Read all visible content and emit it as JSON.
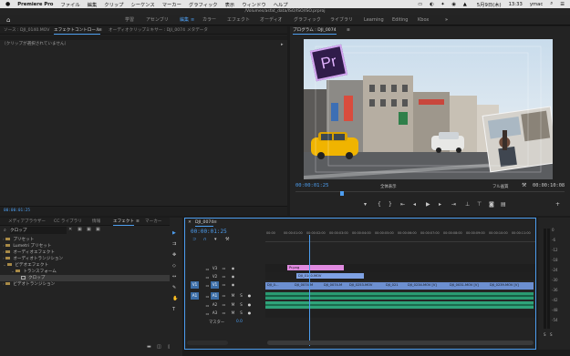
{
  "menubar": {
    "apple": "",
    "app": "Premiere Pro",
    "items": [
      "ファイル",
      "編集",
      "クリップ",
      "シーケンス",
      "マーカー",
      "グラフィック",
      "表示",
      "ウィンドウ",
      "ヘルプ"
    ],
    "status_date": "5月9日(木)",
    "status_time": "13:33",
    "status_user": "ymac"
  },
  "title_path": "/Volumes/asfat_data/ISO/ISO/ISO.prproj",
  "workspaces": {
    "items": [
      "学習",
      "アセンブリ",
      "編集",
      "カラー",
      "エフェクト",
      "オーディオ",
      "グラフィック",
      "ライブラリ",
      "Learning",
      "Editing",
      "Kbox"
    ],
    "active_index": 2,
    "more": "»"
  },
  "source_panel": {
    "tabs": [
      "ソース : DJI_0140.MOV",
      "エフェクトコントロール",
      "オーディオクリップミキサー : DJI_0074",
      "メタデータ"
    ],
    "menu": "≡",
    "active_tab": 1,
    "message": "（クリップが選択されていません）",
    "timecode": "00:00:01:25"
  },
  "program": {
    "title": "プログラム : DJI_0074",
    "menu": "≡",
    "timecode": "00:00:01:25",
    "fit": "全体表示",
    "quality": "フル画質",
    "duration": "00:00:10:08",
    "logo_text": "Pr"
  },
  "effects": {
    "tabs": [
      "メディアブラウザー",
      "CC ライブラリ",
      "情報",
      "エフェクト",
      "マーカー"
    ],
    "more": "»",
    "active_tab": 3,
    "search_value": "クロップ",
    "tree": [
      {
        "label": "プリセット",
        "indent": 0
      },
      {
        "label": "Lumetri プリセット",
        "indent": 0
      },
      {
        "label": "オーディオエフェクト",
        "indent": 0
      },
      {
        "label": "オーディオトランジション",
        "indent": 0
      },
      {
        "label": "ビデオエフェクト",
        "indent": 0
      },
      {
        "label": "トランスフォーム",
        "indent": 1
      },
      {
        "label": "クロップ",
        "indent": 2,
        "selected": true
      },
      {
        "label": "ビデオトランジション",
        "indent": 0
      }
    ]
  },
  "timeline": {
    "tab": "DJI_0074",
    "timecode": "00:00:01:25",
    "ruler": [
      "00:00",
      "00:00:01:00",
      "00:00:02:00",
      "00:00:03:00",
      "00:00:04:00",
      "00:00:05:00",
      "00:00:06:00",
      "00:00:07:00",
      "00:00:08:00",
      "00:00:09:00",
      "00:00:10:00",
      "00:00:11:00"
    ],
    "tracks": [
      "V3",
      "V2",
      "V1",
      "A1",
      "A2",
      "A3"
    ],
    "source_patches": [
      "V1",
      "A1"
    ],
    "master_label": "マスター",
    "master_value": "0.0",
    "clips": {
      "v3": "Pr.png",
      "v2": "DJI_0140.MOV",
      "v1": [
        "DJI_0…",
        "DJI_0074.M",
        "DJI_0074.M",
        "DJI_0253.MOV",
        "DJI_021",
        "DJI_0234.MOV [V]",
        "DJI_0031.MOV [V]",
        "DJI_0239.MOV [V]"
      ]
    }
  },
  "meter": {
    "db": [
      "0",
      "-6",
      "-12",
      "-18",
      "-24",
      "-30",
      "-36",
      "-42",
      "-48",
      "-54"
    ],
    "solo": "S",
    "solo2": "S"
  },
  "colors": {
    "accent": "#4d9ef0",
    "video_clip": "#6c8fd0",
    "pink_clip": "#d07ad0",
    "audio_clip": "#2fa37a"
  }
}
